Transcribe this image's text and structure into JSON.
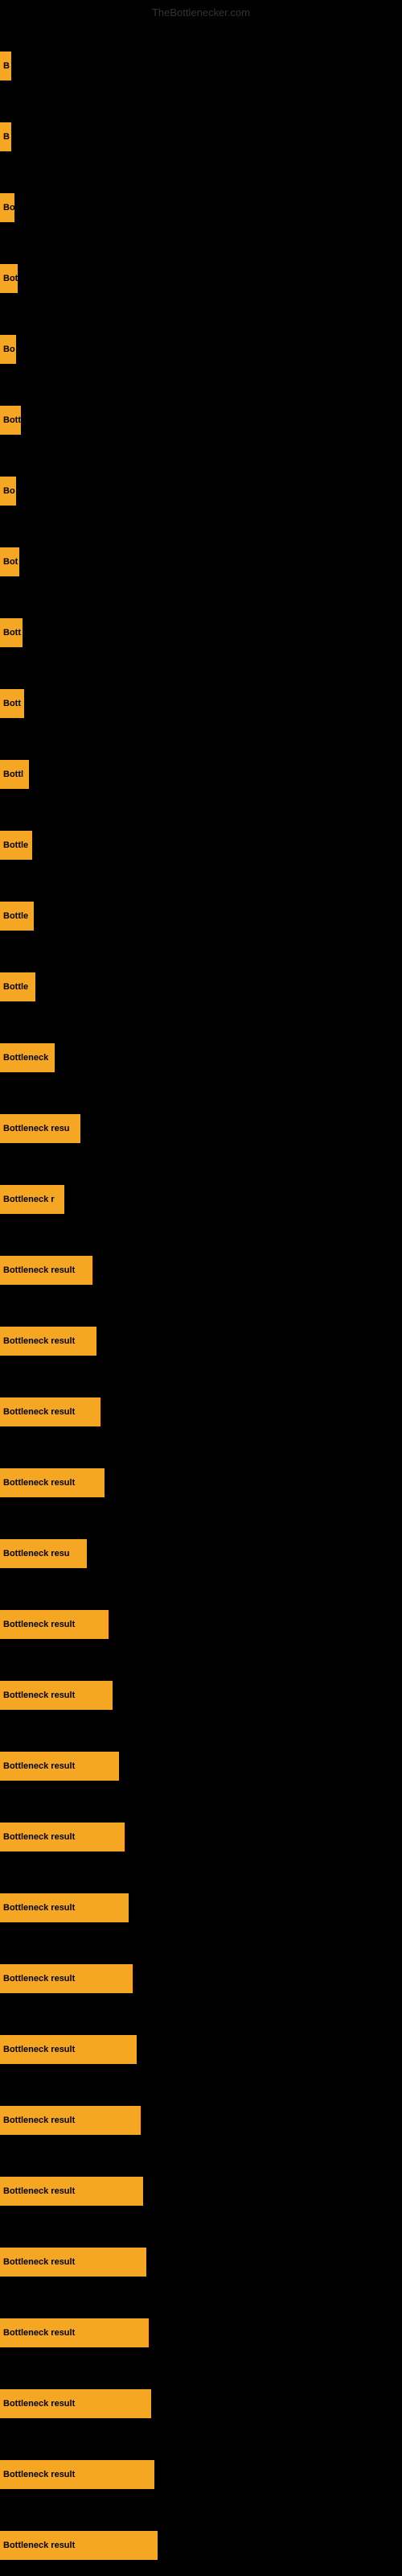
{
  "site": {
    "title": "TheBottlenecker.com"
  },
  "bars": [
    {
      "id": 1,
      "label": "B",
      "width": 14
    },
    {
      "id": 2,
      "label": "B",
      "width": 14
    },
    {
      "id": 3,
      "label": "Bo",
      "width": 18
    },
    {
      "id": 4,
      "label": "Bot",
      "width": 22
    },
    {
      "id": 5,
      "label": "Bo",
      "width": 20
    },
    {
      "id": 6,
      "label": "Bott",
      "width": 26
    },
    {
      "id": 7,
      "label": "Bo",
      "width": 20
    },
    {
      "id": 8,
      "label": "Bot",
      "width": 24
    },
    {
      "id": 9,
      "label": "Bott",
      "width": 28
    },
    {
      "id": 10,
      "label": "Bott",
      "width": 30
    },
    {
      "id": 11,
      "label": "Bottl",
      "width": 36
    },
    {
      "id": 12,
      "label": "Bottle",
      "width": 40
    },
    {
      "id": 13,
      "label": "Bottle",
      "width": 42
    },
    {
      "id": 14,
      "label": "Bottle",
      "width": 44
    },
    {
      "id": 15,
      "label": "Bottleneck",
      "width": 68
    },
    {
      "id": 16,
      "label": "Bottleneck resu",
      "width": 100
    },
    {
      "id": 17,
      "label": "Bottleneck r",
      "width": 80
    },
    {
      "id": 18,
      "label": "Bottleneck result",
      "width": 115
    },
    {
      "id": 19,
      "label": "Bottleneck result",
      "width": 120
    },
    {
      "id": 20,
      "label": "Bottleneck result",
      "width": 125
    },
    {
      "id": 21,
      "label": "Bottleneck result",
      "width": 130
    },
    {
      "id": 22,
      "label": "Bottleneck resu",
      "width": 108
    },
    {
      "id": 23,
      "label": "Bottleneck result",
      "width": 135
    },
    {
      "id": 24,
      "label": "Bottleneck result",
      "width": 140
    },
    {
      "id": 25,
      "label": "Bottleneck result",
      "width": 148
    },
    {
      "id": 26,
      "label": "Bottleneck result",
      "width": 155
    },
    {
      "id": 27,
      "label": "Bottleneck result",
      "width": 160
    },
    {
      "id": 28,
      "label": "Bottleneck result",
      "width": 165
    },
    {
      "id": 29,
      "label": "Bottleneck result",
      "width": 170
    },
    {
      "id": 30,
      "label": "Bottleneck result",
      "width": 175
    },
    {
      "id": 31,
      "label": "Bottleneck result",
      "width": 178
    },
    {
      "id": 32,
      "label": "Bottleneck result",
      "width": 182
    },
    {
      "id": 33,
      "label": "Bottleneck result",
      "width": 185
    },
    {
      "id": 34,
      "label": "Bottleneck result",
      "width": 188
    },
    {
      "id": 35,
      "label": "Bottleneck result",
      "width": 192
    },
    {
      "id": 36,
      "label": "Bottleneck result",
      "width": 196
    }
  ]
}
